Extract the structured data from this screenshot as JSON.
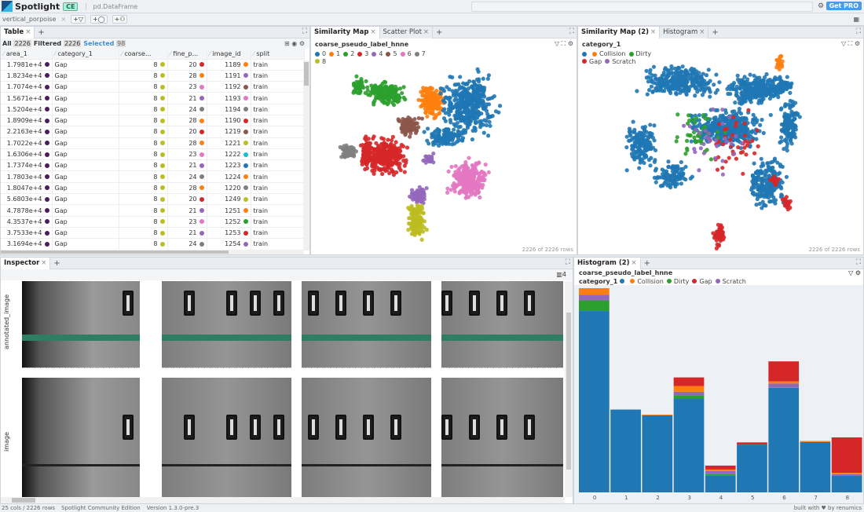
{
  "app": {
    "name": "Spotlight",
    "edition_badge": "CE",
    "dataset": "pd.DataFrame",
    "get_pro": "Get PRO"
  },
  "toolbar": {
    "workspace": "vertical_porpoise",
    "add_filter": "+▽",
    "add_tag": "+◯",
    "add_similar": "+⚇"
  },
  "table": {
    "tab": "Table",
    "all_label": "All",
    "all_count": "2226",
    "filtered_label": "Filtered",
    "filtered_count": "2226",
    "selected_label": "Selected",
    "selected_count": "98",
    "columns": [
      "area_1",
      "category_1",
      "coarse...",
      "fine_p...",
      "image_id",
      "split"
    ],
    "rows": [
      [
        "1.7981e+4",
        "Gap",
        "8",
        "20",
        "1189",
        "train",
        "#d62728",
        "#ff7f0e"
      ],
      [
        "1.8234e+4",
        "Gap",
        "8",
        "28",
        "1191",
        "train",
        "#ff7f0e",
        "#9467bd"
      ],
      [
        "1.7074e+4",
        "Gap",
        "8",
        "23",
        "1192",
        "train",
        "#e377c2",
        "#8c564b"
      ],
      [
        "1.5671e+4",
        "Gap",
        "8",
        "21",
        "1193",
        "train",
        "#9467bd",
        "#e377c2"
      ],
      [
        "1.5204e+4",
        "Gap",
        "8",
        "24",
        "1194",
        "train",
        "#7f7f7f",
        "#7f7f7f"
      ],
      [
        "1.8909e+4",
        "Gap",
        "8",
        "28",
        "1190",
        "train",
        "#ff7f0e",
        "#d62728"
      ],
      [
        "2.2163e+4",
        "Gap",
        "8",
        "20",
        "1219",
        "train",
        "#d62728",
        "#8c564b"
      ],
      [
        "1.7022e+4",
        "Gap",
        "8",
        "28",
        "1221",
        "train",
        "#ff7f0e",
        "#bcbd22"
      ],
      [
        "1.6306e+4",
        "Gap",
        "8",
        "23",
        "1222",
        "train",
        "#e377c2",
        "#17becf"
      ],
      [
        "1.7374e+4",
        "Gap",
        "8",
        "21",
        "1223",
        "train",
        "#9467bd",
        "#1f77b4"
      ],
      [
        "1.7803e+4",
        "Gap",
        "8",
        "24",
        "1224",
        "train",
        "#7f7f7f",
        "#ff7f0e"
      ],
      [
        "1.8047e+4",
        "Gap",
        "8",
        "28",
        "1220",
        "train",
        "#ff7f0e",
        "#7f7f7f"
      ],
      [
        "5.6803e+4",
        "Gap",
        "8",
        "20",
        "1249",
        "train",
        "#d62728",
        "#bcbd22"
      ],
      [
        "4.7878e+4",
        "Gap",
        "8",
        "21",
        "1251",
        "train",
        "#9467bd",
        "#ff7f0e"
      ],
      [
        "4.3537e+4",
        "Gap",
        "8",
        "23",
        "1252",
        "train",
        "#e377c2",
        "#2ca02c"
      ],
      [
        "3.7533e+4",
        "Gap",
        "8",
        "21",
        "1253",
        "train",
        "#9467bd",
        "#d62728"
      ],
      [
        "3.1694e+4",
        "Gap",
        "8",
        "24",
        "1254",
        "train",
        "#7f7f7f",
        "#9467bd"
      ]
    ]
  },
  "simmap1": {
    "tabs": [
      "Similarity Map",
      "Scatter Plot"
    ],
    "color_by": "coarse_pseudo_label_hnne",
    "legend": [
      "0",
      "1",
      "2",
      "3",
      "4",
      "5",
      "6",
      "7",
      "8"
    ],
    "rows": "2226 of 2226 rows"
  },
  "simmap2": {
    "tabs": [
      "Similarity Map (2)",
      "Histogram"
    ],
    "color_by": "category_1",
    "legend": [
      "",
      "Collision",
      "Dirty",
      "Gap",
      "Scratch"
    ],
    "rows": "2226 of 2226 rows"
  },
  "palette": [
    "#1f77b4",
    "#ff7f0e",
    "#2ca02c",
    "#d62728",
    "#9467bd",
    "#8c564b",
    "#e377c2",
    "#7f7f7f",
    "#bcbd22"
  ],
  "inspector": {
    "tab": "Inspector",
    "columns_count": "4",
    "row_labels": [
      "annotated_image",
      "image"
    ]
  },
  "histogram": {
    "tab": "Histogram (2)",
    "column": "coarse_pseudo_label_hnne",
    "stack_by": "category_1"
  },
  "chart_data": {
    "type": "bar",
    "stacked": true,
    "categories": [
      "0",
      "1",
      "2",
      "3",
      "4",
      "5",
      "6",
      "7",
      "8"
    ],
    "series": [
      {
        "name": "",
        "color": "#1f77b4",
        "values": [
          508,
          232,
          216,
          263,
          47,
          134,
          293,
          141,
          47
        ]
      },
      {
        "name": "Dirty",
        "color": "#2ca02c",
        "values": [
          30,
          0,
          0,
          9,
          4,
          0,
          1,
          0,
          0
        ]
      },
      {
        "name": "Scratch",
        "color": "#9467bd",
        "values": [
          16,
          0,
          0,
          10,
          9,
          0,
          11,
          0,
          4
        ]
      },
      {
        "name": "Collision",
        "color": "#ff7f0e",
        "values": [
          18,
          0,
          2,
          16,
          4,
          0,
          6,
          3,
          4
        ]
      },
      {
        "name": "Gap",
        "color": "#d62728",
        "values": [
          0,
          0,
          0,
          24,
          11,
          6,
          56,
          0,
          99
        ]
      }
    ],
    "xlabel": "",
    "ylabel": ""
  },
  "status": {
    "cols_rows": "25 cols / 2226 rows",
    "edition": "Spotlight Community Edition",
    "version": "Version 1.3.0-pre.3",
    "built": "built with ♥ by renumics"
  }
}
